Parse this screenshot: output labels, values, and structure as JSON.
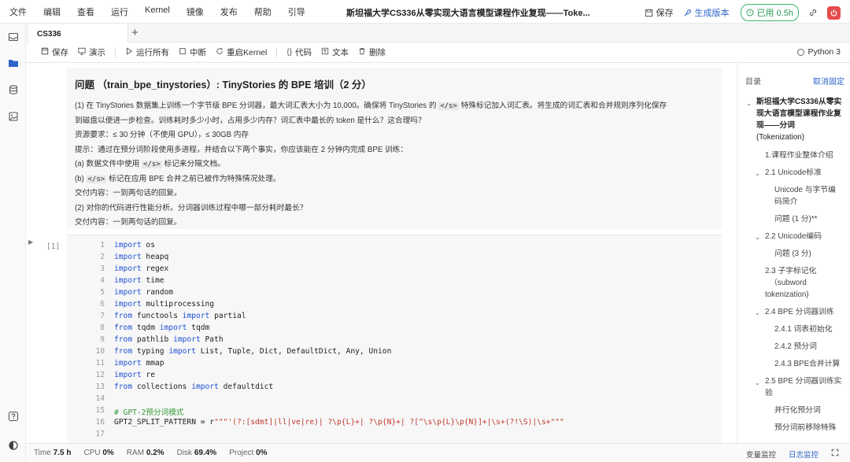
{
  "menu": [
    "文件",
    "编辑",
    "查看",
    "运行",
    "Kernel",
    "镜像",
    "发布",
    "帮助",
    "引导"
  ],
  "title": "斯坦福大学CS336从零实现大语言模型课程作业复现——Toke...",
  "top_right": {
    "save": "保存",
    "generate": "生成版本",
    "usage": "已用 0.5h"
  },
  "tab": {
    "name": "CS336",
    "add": "+"
  },
  "toolbar": {
    "save": "保存",
    "present": "演示",
    "run_all": "运行所有",
    "interrupt": "中断",
    "restart": "重启Kernel",
    "code": "代码",
    "text": "文本",
    "delete": "删除",
    "kernel": "Python 3"
  },
  "markdown": {
    "heading": "问题 （train_bpe_tinystories）: TinyStories 的 BPE 培训（2 分）",
    "p1a": "(1) 在 TinyStories 数据集上训练一个字节级 BPE 分词器，最大词汇表大小为 10,000。确保将 TinyStories 的",
    "p1b": "特殊标记加入词汇表。将生成的词汇表和合并规则序列化保存",
    "p2": "到磁盘以便进一步检查。训练耗时多少小时，占用多少内存？词汇表中最长的 token 是什么？这合理吗？",
    "p3": "资源要求：≤ 30 分钟（不使用 GPU），≤ 30GB 内存",
    "p4": "提示：通过在预分词阶段使用多进程，并结合以下两个事实，你应该能在 2 分钟内完成 BPE 训练：",
    "p5a": "(a) 数据文件中使用",
    "p5b": "标记来分隔文档。",
    "p6a": "(b)",
    "p6b": "标记在应用 BPE 合并之前已被作为特殊情况处理。",
    "p7": "交付内容：一到两句话的回复。",
    "p8": "(2) 对你的代码进行性能分析。分词器训练过程中哪一部分耗时最长？",
    "p9": "交付内容：一到两句话的回复。",
    "token": "</s>"
  },
  "cell": {
    "exec": "[1]"
  },
  "code_lines": [
    [
      {
        "t": "import",
        "c": "kw"
      },
      {
        "t": " os",
        "c": "plain"
      }
    ],
    [
      {
        "t": "import",
        "c": "kw"
      },
      {
        "t": " heapq",
        "c": "plain"
      }
    ],
    [
      {
        "t": "import",
        "c": "kw"
      },
      {
        "t": " regex",
        "c": "plain"
      }
    ],
    [
      {
        "t": "import",
        "c": "kw"
      },
      {
        "t": " time",
        "c": "plain"
      }
    ],
    [
      {
        "t": "import",
        "c": "kw"
      },
      {
        "t": " random",
        "c": "plain"
      }
    ],
    [
      {
        "t": "import",
        "c": "kw"
      },
      {
        "t": " multiprocessing",
        "c": "plain"
      }
    ],
    [
      {
        "t": "from",
        "c": "kw"
      },
      {
        "t": " functools ",
        "c": "plain"
      },
      {
        "t": "import",
        "c": "kw"
      },
      {
        "t": " partial",
        "c": "plain"
      }
    ],
    [
      {
        "t": "from",
        "c": "kw"
      },
      {
        "t": " tqdm ",
        "c": "plain"
      },
      {
        "t": "import",
        "c": "kw"
      },
      {
        "t": " tqdm",
        "c": "plain"
      }
    ],
    [
      {
        "t": "from",
        "c": "kw"
      },
      {
        "t": " pathlib ",
        "c": "plain"
      },
      {
        "t": "import",
        "c": "kw"
      },
      {
        "t": " Path",
        "c": "plain"
      }
    ],
    [
      {
        "t": "from",
        "c": "kw"
      },
      {
        "t": " typing ",
        "c": "plain"
      },
      {
        "t": "import",
        "c": "kw"
      },
      {
        "t": " List, Tuple, Dict, DefaultDict, Any, Union",
        "c": "plain"
      }
    ],
    [
      {
        "t": "import",
        "c": "kw"
      },
      {
        "t": " mmap",
        "c": "plain"
      }
    ],
    [
      {
        "t": "import",
        "c": "kw"
      },
      {
        "t": " re",
        "c": "plain"
      }
    ],
    [
      {
        "t": "from",
        "c": "kw"
      },
      {
        "t": " collections ",
        "c": "plain"
      },
      {
        "t": "import",
        "c": "kw"
      },
      {
        "t": " defaultdict",
        "c": "plain"
      }
    ],
    [],
    [
      {
        "t": "# GPT-2预分词模式",
        "c": "cm"
      }
    ],
    [
      {
        "t": "GPT2_SPLIT_PATTERN = r",
        "c": "plain"
      },
      {
        "t": "\"\"\"'(?:[sdmt]|ll|ve|re)| ?\\p{L}+| ?\\p{N}+| ?[^\\s\\p{L}\\p{N}]+|\\s+(?!\\S)|\\s+\"\"\"",
        "c": "st"
      }
    ],
    []
  ],
  "toc": {
    "title": "目录",
    "collapse": "取消固定",
    "main1": "斯坦福大学CS336从零实",
    "main2": "现大语言模型课程作业复",
    "main3": "现——分词",
    "main4": "(Tokenization)",
    "s1": "1.课程作业整体介绍",
    "s21": "2.1 Unicode标准",
    "s211a": "Unicode 与字节编",
    "s211b": "码简介",
    "s212": "问题 (1 分)**",
    "s22": "2.2 Unicode编码",
    "s221": "问题 (3 分)",
    "s23a": "2.3 子字标记化",
    "s23b": "（subword",
    "s23c": "tokenization)",
    "s24": "2.4 BPE 分词器训练",
    "s241": "2.4.1 词表初始化",
    "s242": "2.4.2 预分词",
    "s243": "2.4.3 BPE合并计算",
    "s25a": "2.5 BPE 分词器训练实",
    "s25b": "验",
    "s251": "并行化预分词",
    "s252": "预分词前移除特殊"
  },
  "status": {
    "time_label": "Time",
    "time": "7.5 h",
    "cpu_label": "CPU",
    "cpu": "0%",
    "ram_label": "RAM",
    "ram": "0.2%",
    "disk_label": "Disk",
    "disk": "69.4%",
    "project_label": "Project",
    "project": "0%",
    "var_monitor": "变量监控",
    "log_monitor": "日志监控"
  }
}
